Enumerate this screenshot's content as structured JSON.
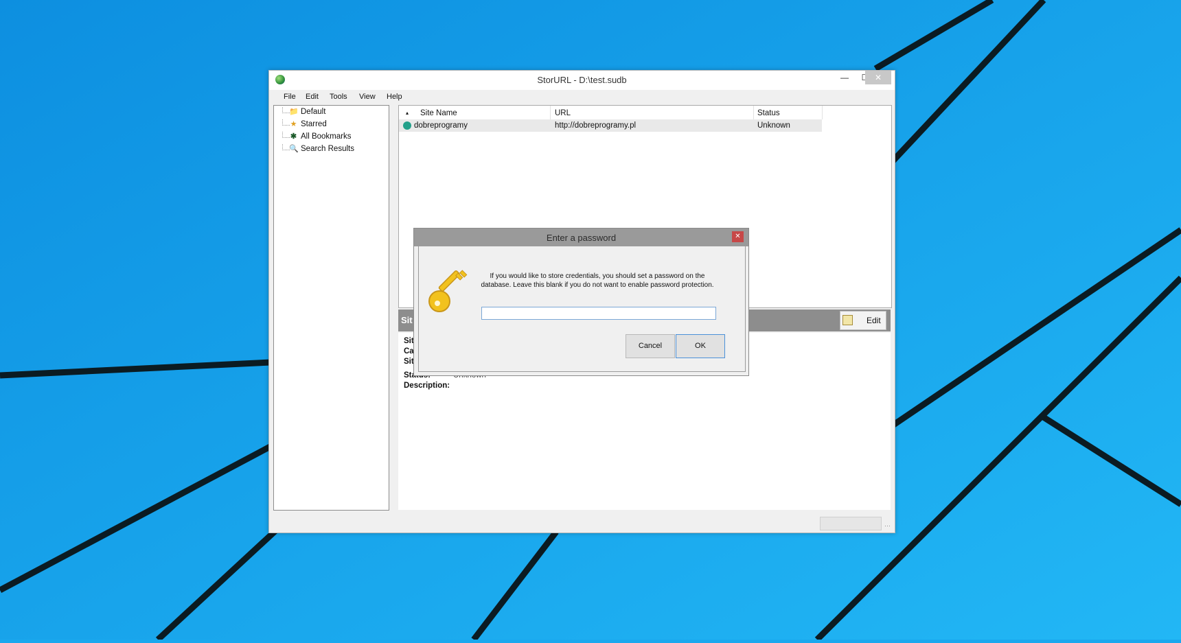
{
  "window": {
    "title": "StorURL - D:\\test.sudb"
  },
  "menu": [
    "File",
    "Edit",
    "Tools",
    "View",
    "Help"
  ],
  "tree": {
    "items": [
      {
        "label": "Default",
        "icon": "folder-icon"
      },
      {
        "label": "Starred",
        "icon": "star-icon"
      },
      {
        "label": "All Bookmarks",
        "icon": "asterisk-icon"
      },
      {
        "label": "Search Results",
        "icon": "search-results-icon"
      }
    ]
  },
  "list": {
    "columns": [
      "Site Name",
      "URL",
      "Status"
    ],
    "sort_indicator": "▴",
    "rows": [
      {
        "site_name": "dobreprogramy",
        "url": "http://dobreprogramy.pl",
        "status": "Unknown"
      }
    ]
  },
  "details": {
    "title": "Sit",
    "edit_label": "Edit",
    "fields": [
      {
        "label": "Sit",
        "value": ""
      },
      {
        "label": "Ca",
        "value": ""
      },
      {
        "label": "Sit",
        "value": ""
      },
      {
        "label": "Status:",
        "value": "Unknown"
      },
      {
        "label": "Description:",
        "value": ""
      }
    ]
  },
  "dialog": {
    "title": "Enter a password",
    "message_line1": "If you would like to store credentials, you should set a password on the",
    "message_line2": "database. Leave this blank if you do not want to enable password protection.",
    "password_value": "",
    "cancel_label": "Cancel",
    "ok_label": "OK"
  },
  "colors": {
    "desktop": "#1aa8ee",
    "accent": "#4a90d9",
    "close": "#c74848"
  }
}
